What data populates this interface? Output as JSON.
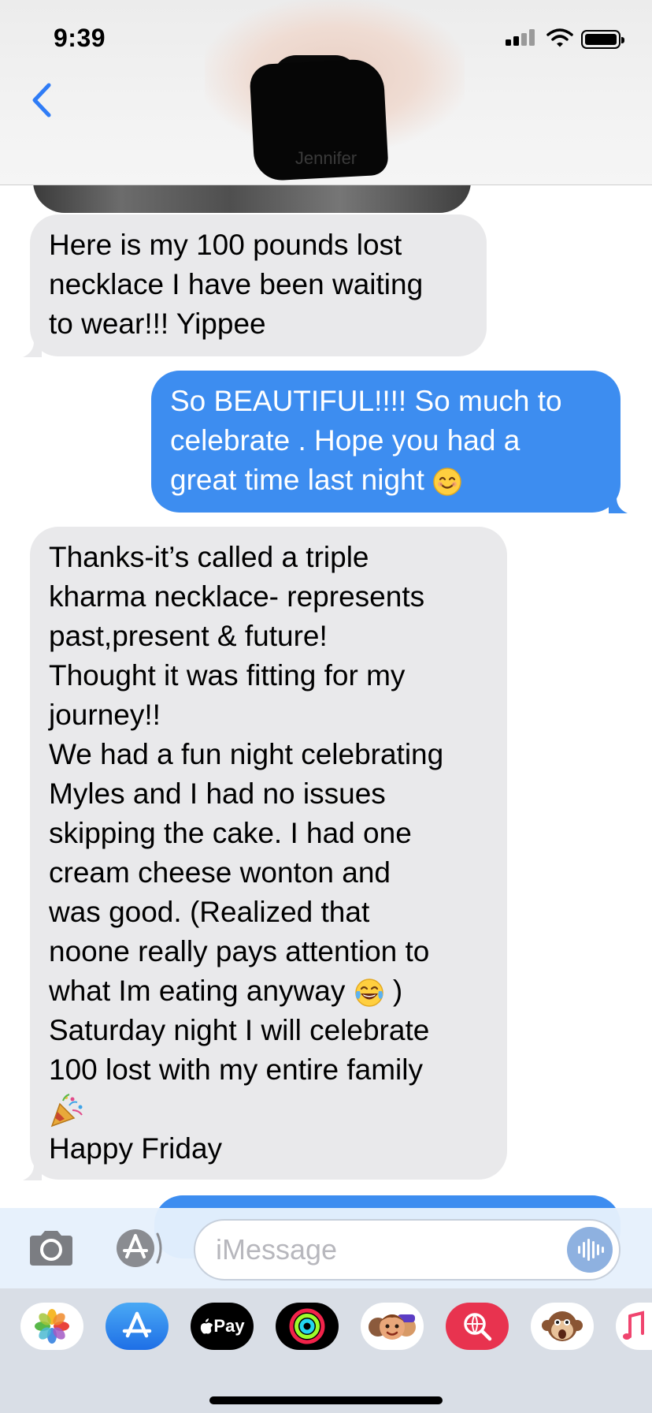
{
  "status_bar": {
    "time": "9:39"
  },
  "header": {
    "contact_name": "Jennifer",
    "back_icon": "chevron-left-icon"
  },
  "messages": [
    {
      "direction": "incoming",
      "lines": [
        "Here is my 100 pounds lost",
        "necklace I have been waiting",
        "to wear!!! Yippee"
      ]
    },
    {
      "direction": "outgoing",
      "lines": [
        "So BEAUTIFUL!!!! So much to",
        "celebrate . Hope you had a",
        "great time last night"
      ],
      "emoji": "smiling-face-icon"
    },
    {
      "direction": "incoming",
      "lines": [
        "Thanks-it’s called a triple",
        "kharma necklace- represents",
        "past,present & future!",
        "Thought it was fitting for my",
        "journey!!",
        "We had a fun night celebrating",
        "Myles and I had no issues",
        "skipping the cake. I had one",
        "cream cheese wonton and",
        "was good.  (Realized that",
        "noone really pays attention to",
        "what Im eating anyway",
        "Saturday night I will celebrate",
        "100 lost with my entire family",
        "",
        "Happy Friday"
      ],
      "line_suffix": ")"
    }
  ],
  "input_bar": {
    "placeholder": "iMessage"
  },
  "app_drawer": {
    "items": [
      "photos-icon",
      "app-store-icon",
      "apple-pay-icon",
      "activity-icon",
      "memoji-icon",
      "web-search-icon",
      "animoji-monkey-icon",
      "music-icon"
    ],
    "apple_pay_label": "Pay"
  },
  "colors": {
    "outgoing_bubble": "#3d8df0",
    "incoming_bubble": "#e9e9eb",
    "accent": "#2f7cf6"
  }
}
